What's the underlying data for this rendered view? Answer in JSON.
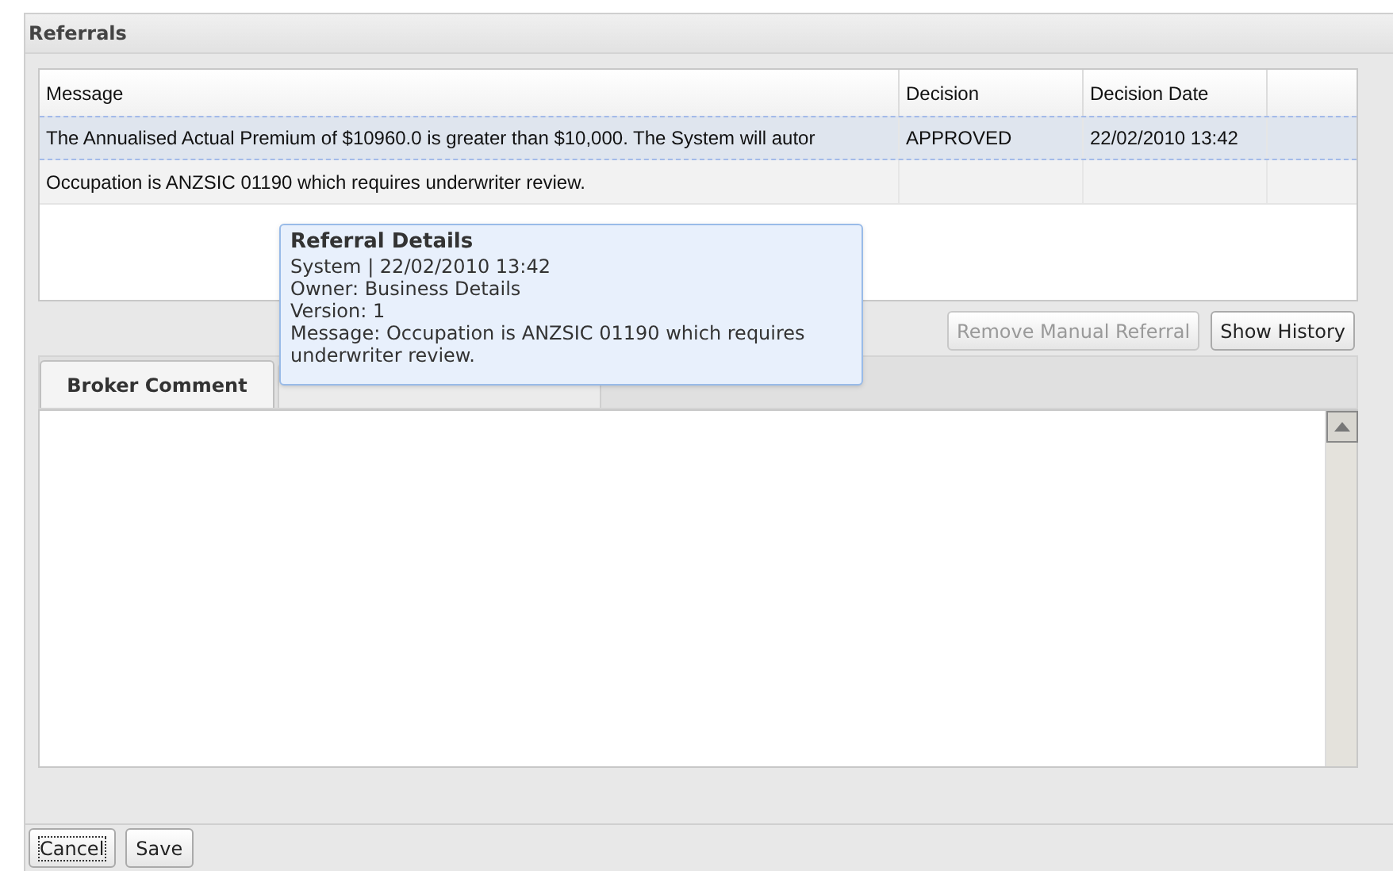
{
  "panel": {
    "title": "Referrals"
  },
  "table": {
    "columns": [
      "Message",
      "Decision",
      "Decision Date"
    ],
    "rows": [
      {
        "message": "The Annualised Actual Premium of $10960.0 is greater than $10,000. The System will autor",
        "decision": "APPROVED",
        "decision_date": "22/02/2010 13:42",
        "selected": true
      },
      {
        "message": "Occupation is ANZSIC 01190 which requires underwriter review.",
        "selected": false
      }
    ]
  },
  "tooltip": {
    "title": "Referral Details",
    "lines": [
      "System | 22/02/2010 13:42",
      "Owner: Business Details",
      "Version: 1",
      "Message: Occupation is ANZSIC 01190 which requires underwriter review."
    ]
  },
  "actions": [
    {
      "label": "Remove Manual Referral",
      "disabled": true
    },
    {
      "label": "Show History",
      "disabled": false
    }
  ],
  "tabs": [
    {
      "label": "Broker Comment",
      "selected": true
    },
    {
      "selected": false
    }
  ],
  "footer_buttons": [
    {
      "label": "Cancel",
      "focused": true
    },
    {
      "label": "Save",
      "focused": false
    }
  ]
}
